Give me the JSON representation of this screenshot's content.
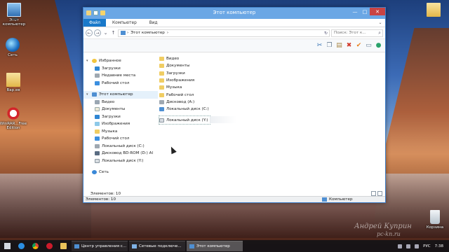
{
  "desktop": {
    "icons": [
      {
        "label": "Этот компьютер",
        "icon": "computer-icon"
      },
      {
        "label": "Сеть",
        "icon": "network-icon"
      },
      {
        "label": "Вар.ев",
        "icon": "folder-icon"
      },
      {
        "label": "WinRAR...Free Edition",
        "icon": "blocked-icon"
      },
      {
        "label": "",
        "icon": "folder-icon"
      },
      {
        "label": "Корзина",
        "icon": "recycle-bin-icon"
      }
    ],
    "watermark": {
      "line1": "Андрей Куприн",
      "line2": "pc-kn.ru"
    }
  },
  "window": {
    "title": "Этот компьютер",
    "controls": {
      "minimize": "—",
      "maximize": "□",
      "close": "✕"
    },
    "ribbon_tabs": [
      "Файл",
      "Компьютер",
      "Вид"
    ],
    "ribbon_expand": "⌄",
    "address": {
      "path": "Этот компьютер",
      "sep": "›",
      "refresh": "↻"
    },
    "search": {
      "placeholder": "Поиск: Этот к...",
      "icon": "⌕"
    },
    "nav": {
      "back": "←",
      "forward": "→",
      "up": "↑",
      "dropdown": "⌄"
    },
    "toolbar_icons": [
      {
        "icon": "scissors-icon",
        "glyph": "✂",
        "color": "#2f6fb2"
      },
      {
        "icon": "copy-icon",
        "glyph": "❐",
        "color": "#6a7f95"
      },
      {
        "icon": "paste-icon",
        "glyph": "▤",
        "color": "#a8884a"
      },
      {
        "icon": "delete-icon",
        "glyph": "✖",
        "color": "#d23a2c"
      },
      {
        "icon": "checkmark-icon",
        "glyph": "✔",
        "color": "#e8801c"
      },
      {
        "icon": "window-icon",
        "glyph": "▭",
        "color": "#6a7f95"
      },
      {
        "icon": "globe-icon",
        "glyph": "●",
        "color": "#2aa26b"
      }
    ],
    "nav_pane": {
      "favorites": {
        "label": "Избранное",
        "items": [
          "Загрузки",
          "Недавние места",
          "Рабочий стол"
        ]
      },
      "computer": {
        "label": "Этот компьютер",
        "items": [
          "Видео",
          "Документы",
          "Загрузки",
          "Изображения",
          "Музыка",
          "Рабочий стол",
          "Локальный диск (C:)",
          "Дисковод BD-ROM (D:) Al",
          "Локальный диск (Y:)"
        ]
      },
      "network": {
        "label": "Сеть"
      }
    },
    "content_items": [
      "Видео",
      "Документы",
      "Загрузки",
      "Изображения",
      "Музыка",
      "Рабочий стол",
      "Дисковод (A:)",
      "Локальный диск (C:)"
    ],
    "selected_item": "Локальный диск (Y:)",
    "element_count": "Элементов: 10",
    "status_left": "Элементов: 10",
    "status_right": "Компьютер"
  },
  "taskbar": {
    "tasks": [
      {
        "label": "Центр управления с...",
        "active": false
      },
      {
        "label": "Сетевые подключе...",
        "active": false
      },
      {
        "label": "Этот компьютер",
        "active": true
      }
    ],
    "language": "РУС",
    "time": "7:38"
  }
}
